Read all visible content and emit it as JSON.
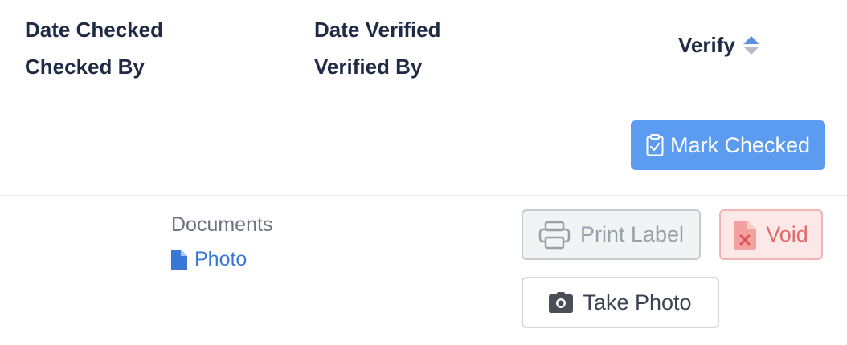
{
  "header": {
    "col1_line1": "Date Checked",
    "col1_line2": "Checked By",
    "col2_line1": "Date Verified",
    "col2_line2": "Verified By",
    "verify_label": "Verify"
  },
  "actions": {
    "mark_checked_label": "Mark Checked",
    "print_label": "Print Label",
    "void_label": "Void",
    "take_photo_label": "Take Photo"
  },
  "documents": {
    "label": "Documents",
    "photo_link": "Photo"
  },
  "colors": {
    "primary": "#5b9cf0",
    "link": "#3a78d8",
    "danger": "#e06a6a",
    "heading": "#1f2a44"
  },
  "icons": {
    "sort": "sort-icon",
    "clipboard_check": "clipboard-check-icon",
    "printer": "printer-icon",
    "file_void": "file-void-icon",
    "file": "file-icon",
    "camera": "camera-icon"
  }
}
